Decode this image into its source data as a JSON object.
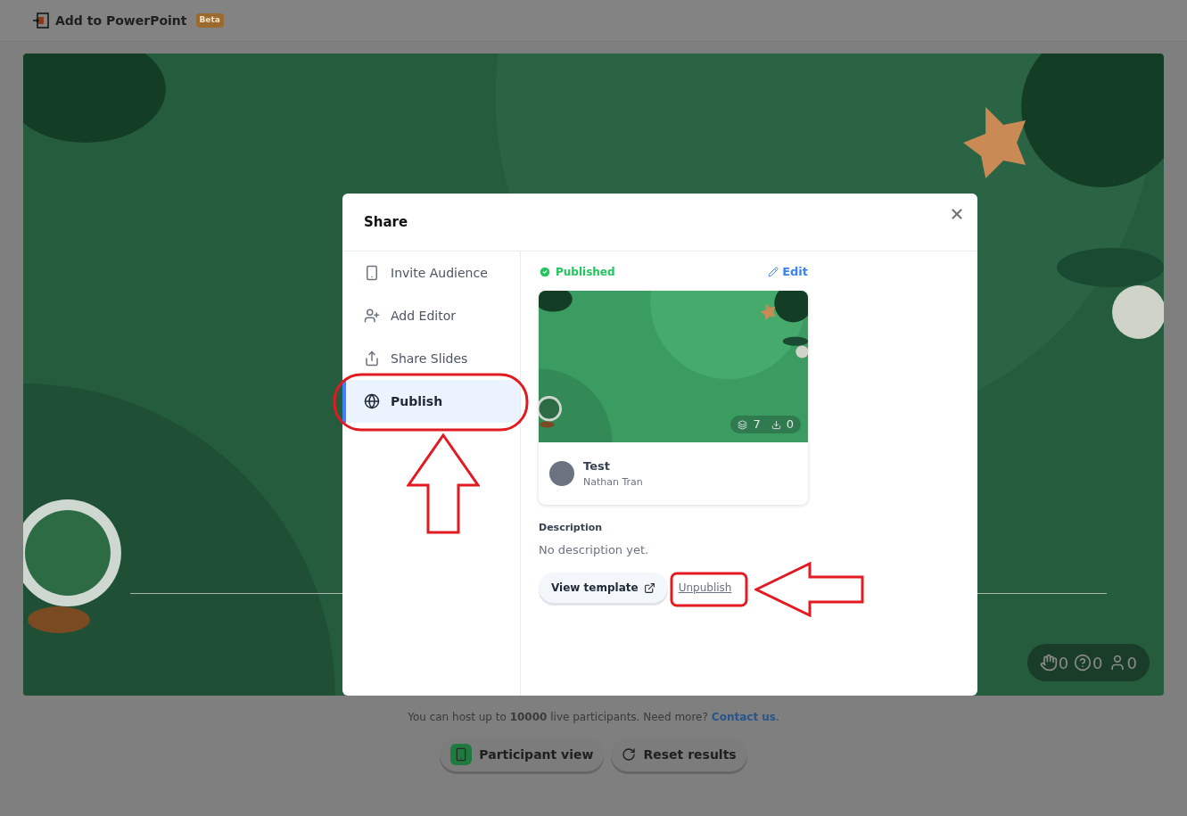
{
  "toolbar": {
    "title": "Add to PowerPoint",
    "badge": "Beta"
  },
  "slide": {
    "stats": [
      {
        "kind": "hand",
        "count": "0"
      },
      {
        "kind": "question",
        "count": "0"
      },
      {
        "kind": "person",
        "count": "0"
      }
    ]
  },
  "dialog": {
    "title": "Share",
    "nav": [
      {
        "label": "Invite Audience",
        "kind": "phone",
        "selected": false
      },
      {
        "label": "Add Editor",
        "kind": "add-user",
        "selected": false
      },
      {
        "label": "Share Slides",
        "kind": "share",
        "selected": false
      },
      {
        "label": "Publish",
        "kind": "globe",
        "selected": true
      }
    ],
    "status": "Published",
    "edit": "Edit",
    "template": {
      "slides": "7",
      "downloads": "0",
      "title": "Test",
      "author": "Nathan Tran"
    },
    "description_label": "Description",
    "description": "No description yet.",
    "view_button": "View template",
    "unpublish": "Unpublish"
  },
  "footer": {
    "note": "You can host up to **10000** live participants. Need more?",
    "link": "Contact us",
    "after": ".",
    "buttons": [
      {
        "label": "Participant view",
        "kind": "phone"
      },
      {
        "label": "Reset results",
        "kind": "reset"
      }
    ]
  }
}
